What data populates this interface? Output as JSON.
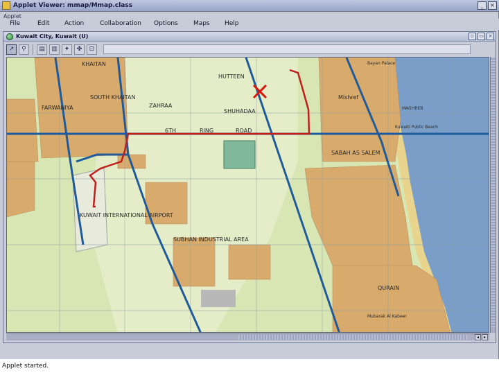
{
  "window": {
    "title": "Applet Viewer: mmap/Mmap.class",
    "applet_label": "Applet",
    "controls": {
      "minimize": "_",
      "close": "×"
    }
  },
  "menu": {
    "items": [
      "File",
      "Edit",
      "Action",
      "Collaboration",
      "Options",
      "Maps",
      "Help"
    ]
  },
  "map_window": {
    "title": "Kuwait City, Kuwait (U)",
    "controls": [
      "▫",
      "▭",
      "×"
    ]
  },
  "toolbar": {
    "tools": [
      {
        "name": "pointer-tool",
        "glyph": "↗"
      },
      {
        "name": "zoom-tool",
        "glyph": "⚲"
      },
      {
        "name": "tool-3",
        "glyph": "▤"
      },
      {
        "name": "tool-4",
        "glyph": "▥"
      },
      {
        "name": "tool-5",
        "glyph": "✦"
      },
      {
        "name": "tool-6",
        "glyph": "✤"
      },
      {
        "name": "tool-7",
        "glyph": "⊡"
      }
    ]
  },
  "map": {
    "labels": [
      "KHAITAN",
      "HUTTEEN",
      "FARWANIYA",
      "SOUTH KHAITAN",
      "ZAHRAA",
      "SHUHADAA",
      "6TH",
      "RING",
      "ROAD",
      "Mishref",
      "Kuwaiti Public Beach",
      "SABAH AS SALEM",
      "KUWAIT INTERNATIONAL AIRPORT",
      "SUBHAN INDUSTRIAL AREA",
      "QURAIN",
      "Bayan Palace",
      "MAGHREB",
      "Mubarak Al Kabeer"
    ],
    "colors": {
      "water": "#7a9ec8",
      "land": "#d8e6b4",
      "urban": "#d8aa6c",
      "route": "#c0201c",
      "highway": "#1f5a9a"
    }
  },
  "status": {
    "text": "Applet started."
  }
}
